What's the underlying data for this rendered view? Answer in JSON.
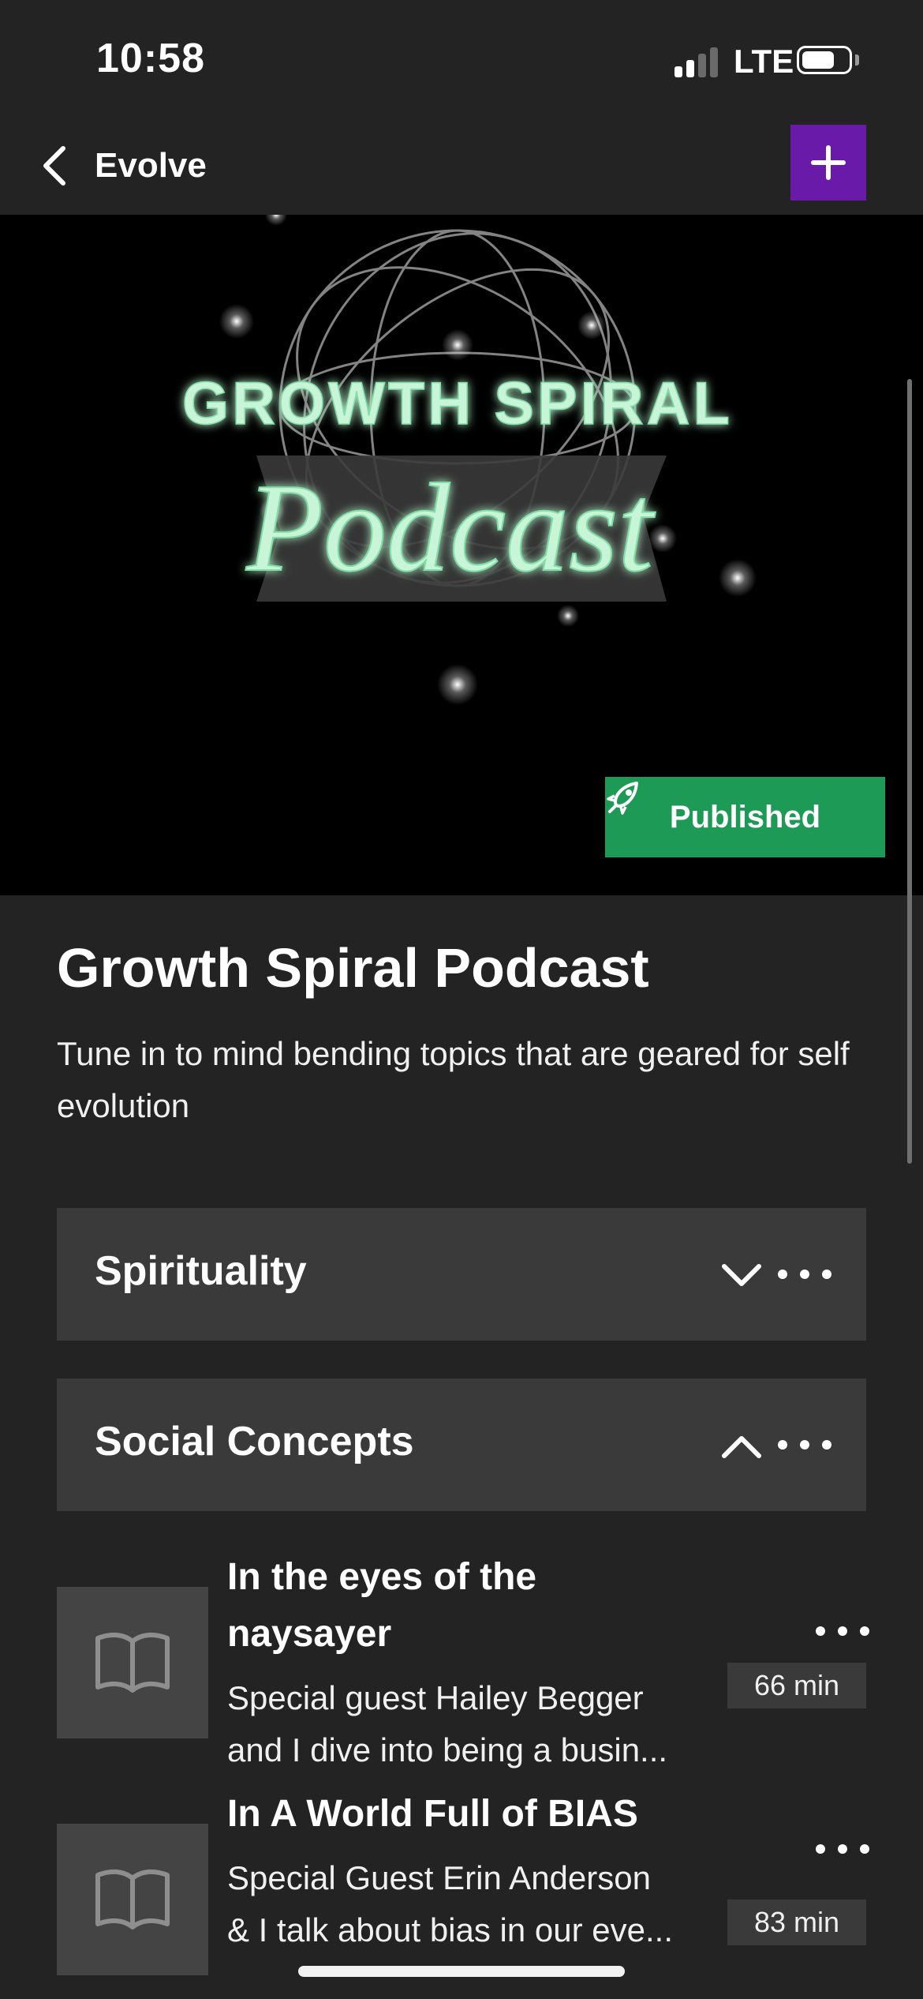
{
  "status_bar": {
    "time": "10:58",
    "network": "LTE"
  },
  "nav": {
    "title": "Evolve",
    "back_icon": "chevron-left-icon",
    "add_icon": "plus-icon",
    "accent_color": "#6a1aa8"
  },
  "cover": {
    "line1": "GROWTH SPIRAL",
    "line2": "Podcast",
    "status_label": "Published",
    "status_icon": "rocket-icon",
    "status_color": "#1d9a55"
  },
  "podcast": {
    "title": "Growth Spiral Podcast",
    "description": "Tune in to mind bending topics that are geared for self evolution"
  },
  "sections": [
    {
      "title": "Spirituality",
      "expanded": false,
      "toggle_icon": "chevron-down-icon",
      "more_icon": "more-horizontal-icon"
    },
    {
      "title": "Social Concepts",
      "expanded": true,
      "toggle_icon": "chevron-up-icon",
      "more_icon": "more-horizontal-icon"
    }
  ],
  "episodes": [
    {
      "title": "In the eyes of the naysayer",
      "description_line1": "Special guest Hailey Begger",
      "description_line2": "and I dive into being a busin...",
      "duration": "66 min",
      "thumb_icon": "book-open-icon"
    },
    {
      "title": "In A World Full of BIAS",
      "description_line1": "Special Guest Erin Anderson",
      "description_line2": "& I talk about bias in our eve...",
      "duration": "83 min",
      "thumb_icon": "book-open-icon"
    }
  ]
}
